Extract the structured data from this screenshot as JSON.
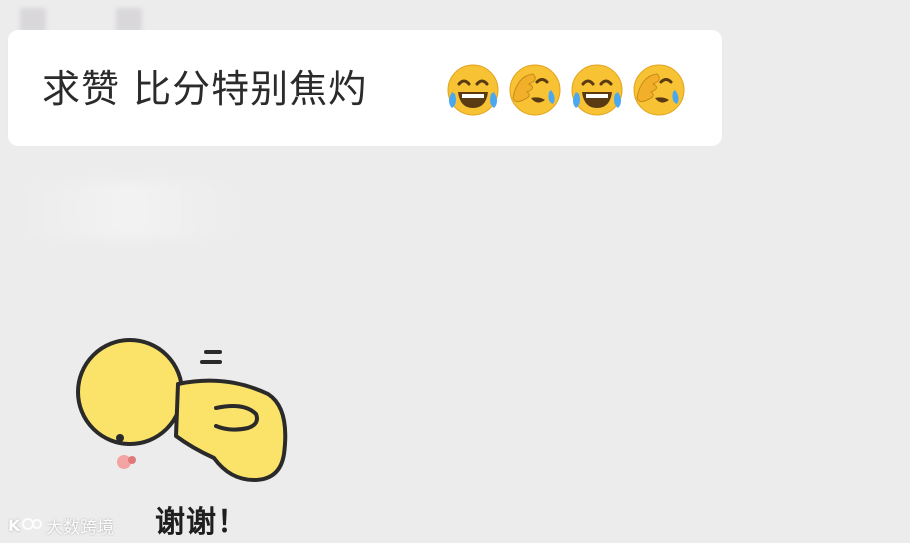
{
  "chat": {
    "message_text": "求赞 比分特别焦灼",
    "emojis": [
      "tears-of-joy-emoji",
      "face-palm-crying-emoji",
      "tears-of-joy-emoji",
      "face-palm-crying-emoji"
    ],
    "sticker_caption": "谢谢！"
  },
  "watermark": {
    "logo": "K",
    "text": "大数跨境"
  },
  "colors": {
    "background": "#ececed",
    "bubble": "#ffffff",
    "emoji_yellow": "#f7c234",
    "sticker_yellow": "#fbe36a"
  }
}
